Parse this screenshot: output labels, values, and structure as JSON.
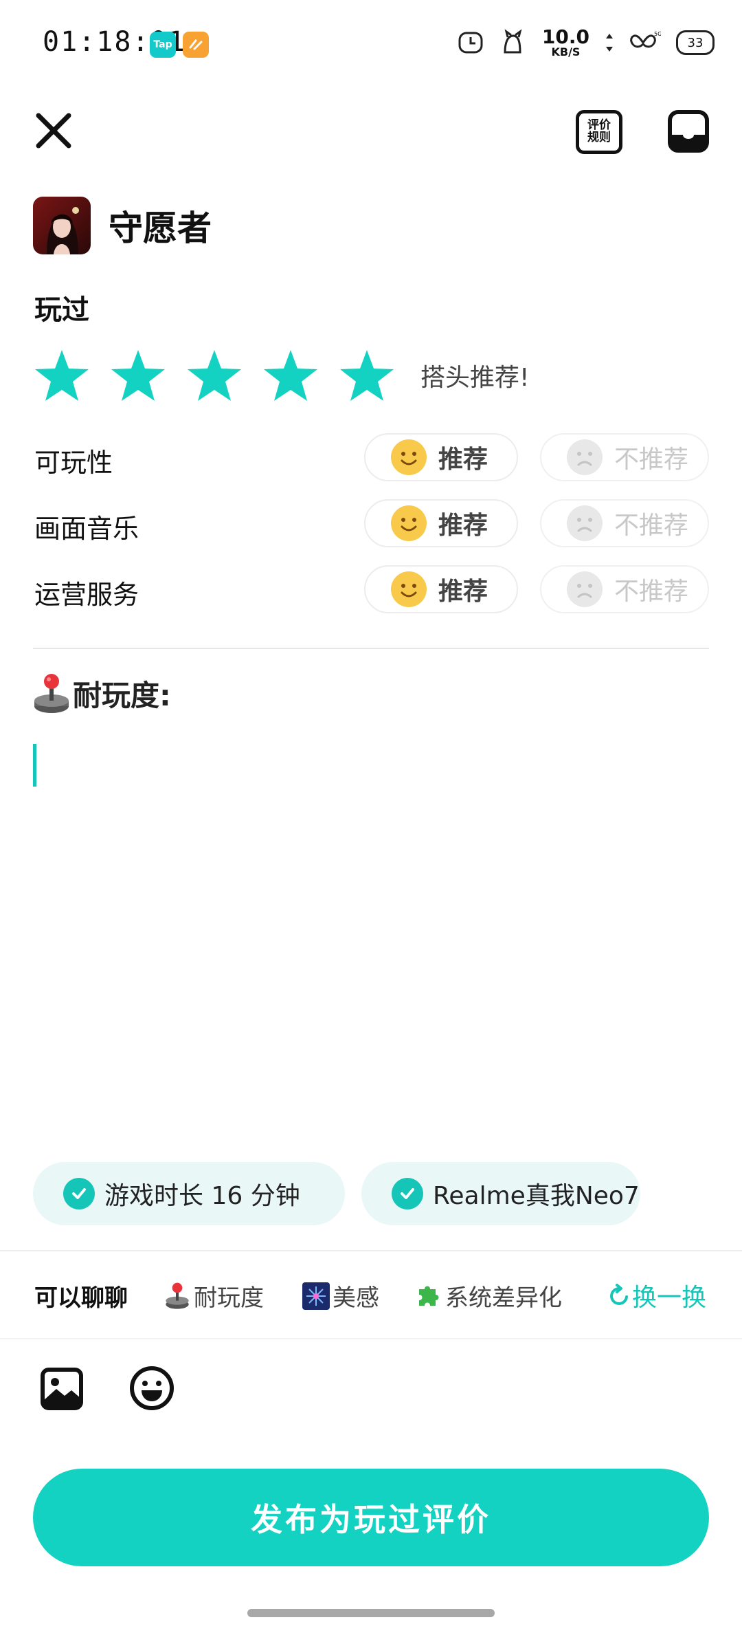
{
  "status_bar": {
    "time": "01:18:01",
    "app_badges": [
      "Tap",
      ""
    ],
    "net_speed_value": "10.0",
    "net_speed_unit": "KB/S",
    "battery": "33"
  },
  "header": {
    "rules_line1": "评价",
    "rules_line2": "规则"
  },
  "game": {
    "title": "守愿者"
  },
  "review": {
    "status_label": "玩过",
    "rating": 5,
    "rating_max": 5,
    "rating_text": "搭头推荐!",
    "prompt": "耐玩度:",
    "input_value": ""
  },
  "aspects": [
    {
      "label": "可玩性",
      "recommend": "推荐",
      "not_recommend": "不推荐"
    },
    {
      "label": "画面音乐",
      "recommend": "推荐",
      "not_recommend": "不推荐"
    },
    {
      "label": "运营服务",
      "recommend": "推荐",
      "not_recommend": "不推荐"
    }
  ],
  "tags": [
    {
      "text": "游戏时长 16 分钟"
    },
    {
      "text": "Realme真我Neo7"
    }
  ],
  "topics": {
    "label": "可以聊聊",
    "items": [
      {
        "text": "耐玩度",
        "icon": "joystick-icon"
      },
      {
        "text": "美感",
        "icon": "fireworks-icon"
      },
      {
        "text": "系统差异化",
        "icon": "puzzle-icon"
      }
    ],
    "switch_label": "换一换"
  },
  "publish_label": "发布为玩过评价",
  "colors": {
    "accent": "#14d2c2",
    "chip_bg": "#e9f8f7"
  }
}
